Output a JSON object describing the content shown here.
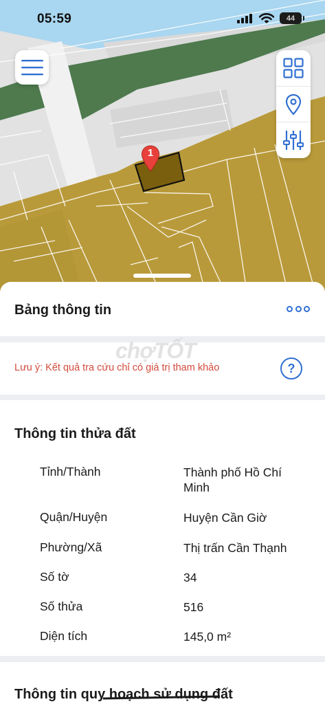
{
  "status_bar": {
    "time": "05:59",
    "battery": "44"
  },
  "map": {
    "marker_label": "1",
    "colors": {
      "sea": "#a9d6f0",
      "greenery": "#4e7a4e",
      "land_use": "#b99a3a",
      "road": "#e4e4e4",
      "selected_parcel": "#7a5f0e",
      "marker": "#e8403a"
    },
    "icons": [
      "menu-icon",
      "grid-icon",
      "location-pin-icon",
      "sliders-icon"
    ]
  },
  "sheet": {
    "title": "Bảng thông tin",
    "note": "Lưu ý: Kết quả tra cứu chỉ có giá trị tham khảo",
    "help_symbol": "?",
    "watermark": "chợTỐT",
    "parcel_section": {
      "title": "Thông tin thửa đất",
      "rows": [
        {
          "label": "Tỉnh/Thành",
          "value": "Thành phố Hồ Chí Minh"
        },
        {
          "label": "Quận/Huyện",
          "value": "Huyện Cần Giờ"
        },
        {
          "label": "Phường/Xã",
          "value": "Thị trấn Cần Thạnh"
        },
        {
          "label": "Số tờ",
          "value": "34"
        },
        {
          "label": "Số thửa",
          "value": "516"
        },
        {
          "label": "Diện tích",
          "value": "145,0 m²"
        }
      ]
    },
    "plan_section": {
      "title": "Thông tin quy hoạch sử dụng đất"
    }
  }
}
